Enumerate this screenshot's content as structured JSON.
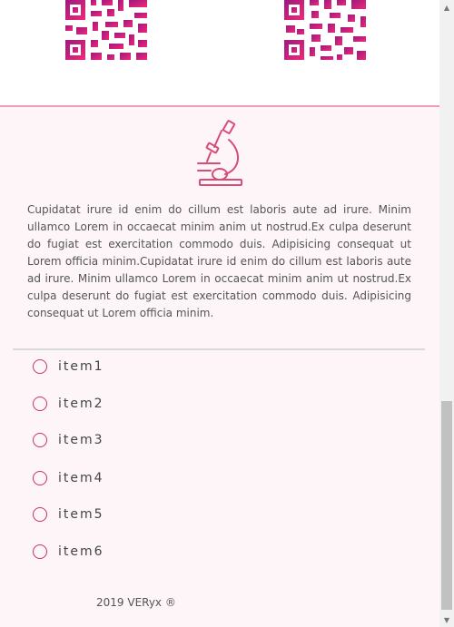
{
  "colors": {
    "accent": "#c7336a",
    "qr_gradient_start": "#9b1a7e",
    "qr_gradient_end": "#f2277a",
    "section_bg": "#fdf5f7",
    "section_border": "#f39bb3"
  },
  "qr_codes": [
    {
      "icon": "qr-code-icon"
    },
    {
      "icon": "qr-code-icon"
    }
  ],
  "hero_icon": "microscope-icon",
  "description": "Cupidatat irure id enim do cillum est laboris aute ad irure. Minim ullamco Lorem in occaecat minim anim ut nostrud.Ex culpa deserunt do fugiat est exercitation commodo duis. Adipisicing consequat ut Lorem officia minim.Cupidatat irure id enim do cillum est laboris aute ad irure. Minim ullamco Lorem in occaecat minim anim ut nostrud.Ex culpa deserunt do fugiat est exercitation commodo duis. Adipisicing consequat ut Lorem officia minim.",
  "items": [
    {
      "label": "item1"
    },
    {
      "label": "item2"
    },
    {
      "label": "item3"
    },
    {
      "label": "item4"
    },
    {
      "label": "item5"
    },
    {
      "label": "item6"
    }
  ],
  "footer": "2019 VERyx ®"
}
